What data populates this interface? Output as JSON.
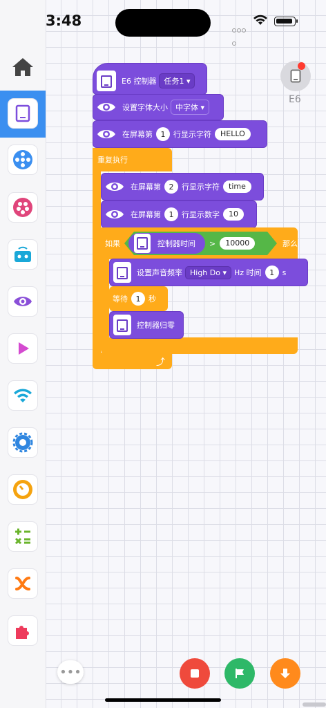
{
  "status": {
    "time": "3:48"
  },
  "sidebar": {
    "categories": [
      "home-icon",
      "controller-icon",
      "motion-icon",
      "light-icon",
      "sensor-icon",
      "eye-icon",
      "play-icon",
      "wifi-icon",
      "gear-icon",
      "timer-icon",
      "math-icon",
      "variable-icon",
      "puzzle-icon"
    ]
  },
  "device": {
    "label": "E6"
  },
  "blocks": {
    "hat": {
      "title": "E6 控制器",
      "task": "任务1"
    },
    "font": {
      "label": "设置字体大小",
      "value": "中字体"
    },
    "line1": {
      "prefix": "在屏幕第",
      "row": "1",
      "suffix": "行显示字符",
      "text": "HELLO"
    },
    "loop": {
      "label": "重复执行"
    },
    "line2": {
      "prefix": "在屏幕第",
      "row": "2",
      "suffix": "行显示字符",
      "text": "time"
    },
    "line3": {
      "prefix": "在屏幕第",
      "row": "1",
      "suffix": "行显示数字",
      "text": "10"
    },
    "if": {
      "label": "如果",
      "then": "那么"
    },
    "cond": {
      "sensor": "控制器时间",
      "op": ">",
      "value": "10000"
    },
    "sound": {
      "label": "设置声音频率",
      "note": "High Do",
      "mid": "Hz 时间",
      "secs": "1",
      "unit": "s"
    },
    "wait": {
      "label": "等待",
      "secs": "1",
      "unit": "秒"
    },
    "reset": {
      "label": "控制器归零"
    }
  },
  "colors": {
    "purple": "#7c4ddc",
    "orange": "#ffab1a",
    "green": "#55b747",
    "accent": "#3b8ff0"
  },
  "bottom": {
    "more": "•••"
  }
}
